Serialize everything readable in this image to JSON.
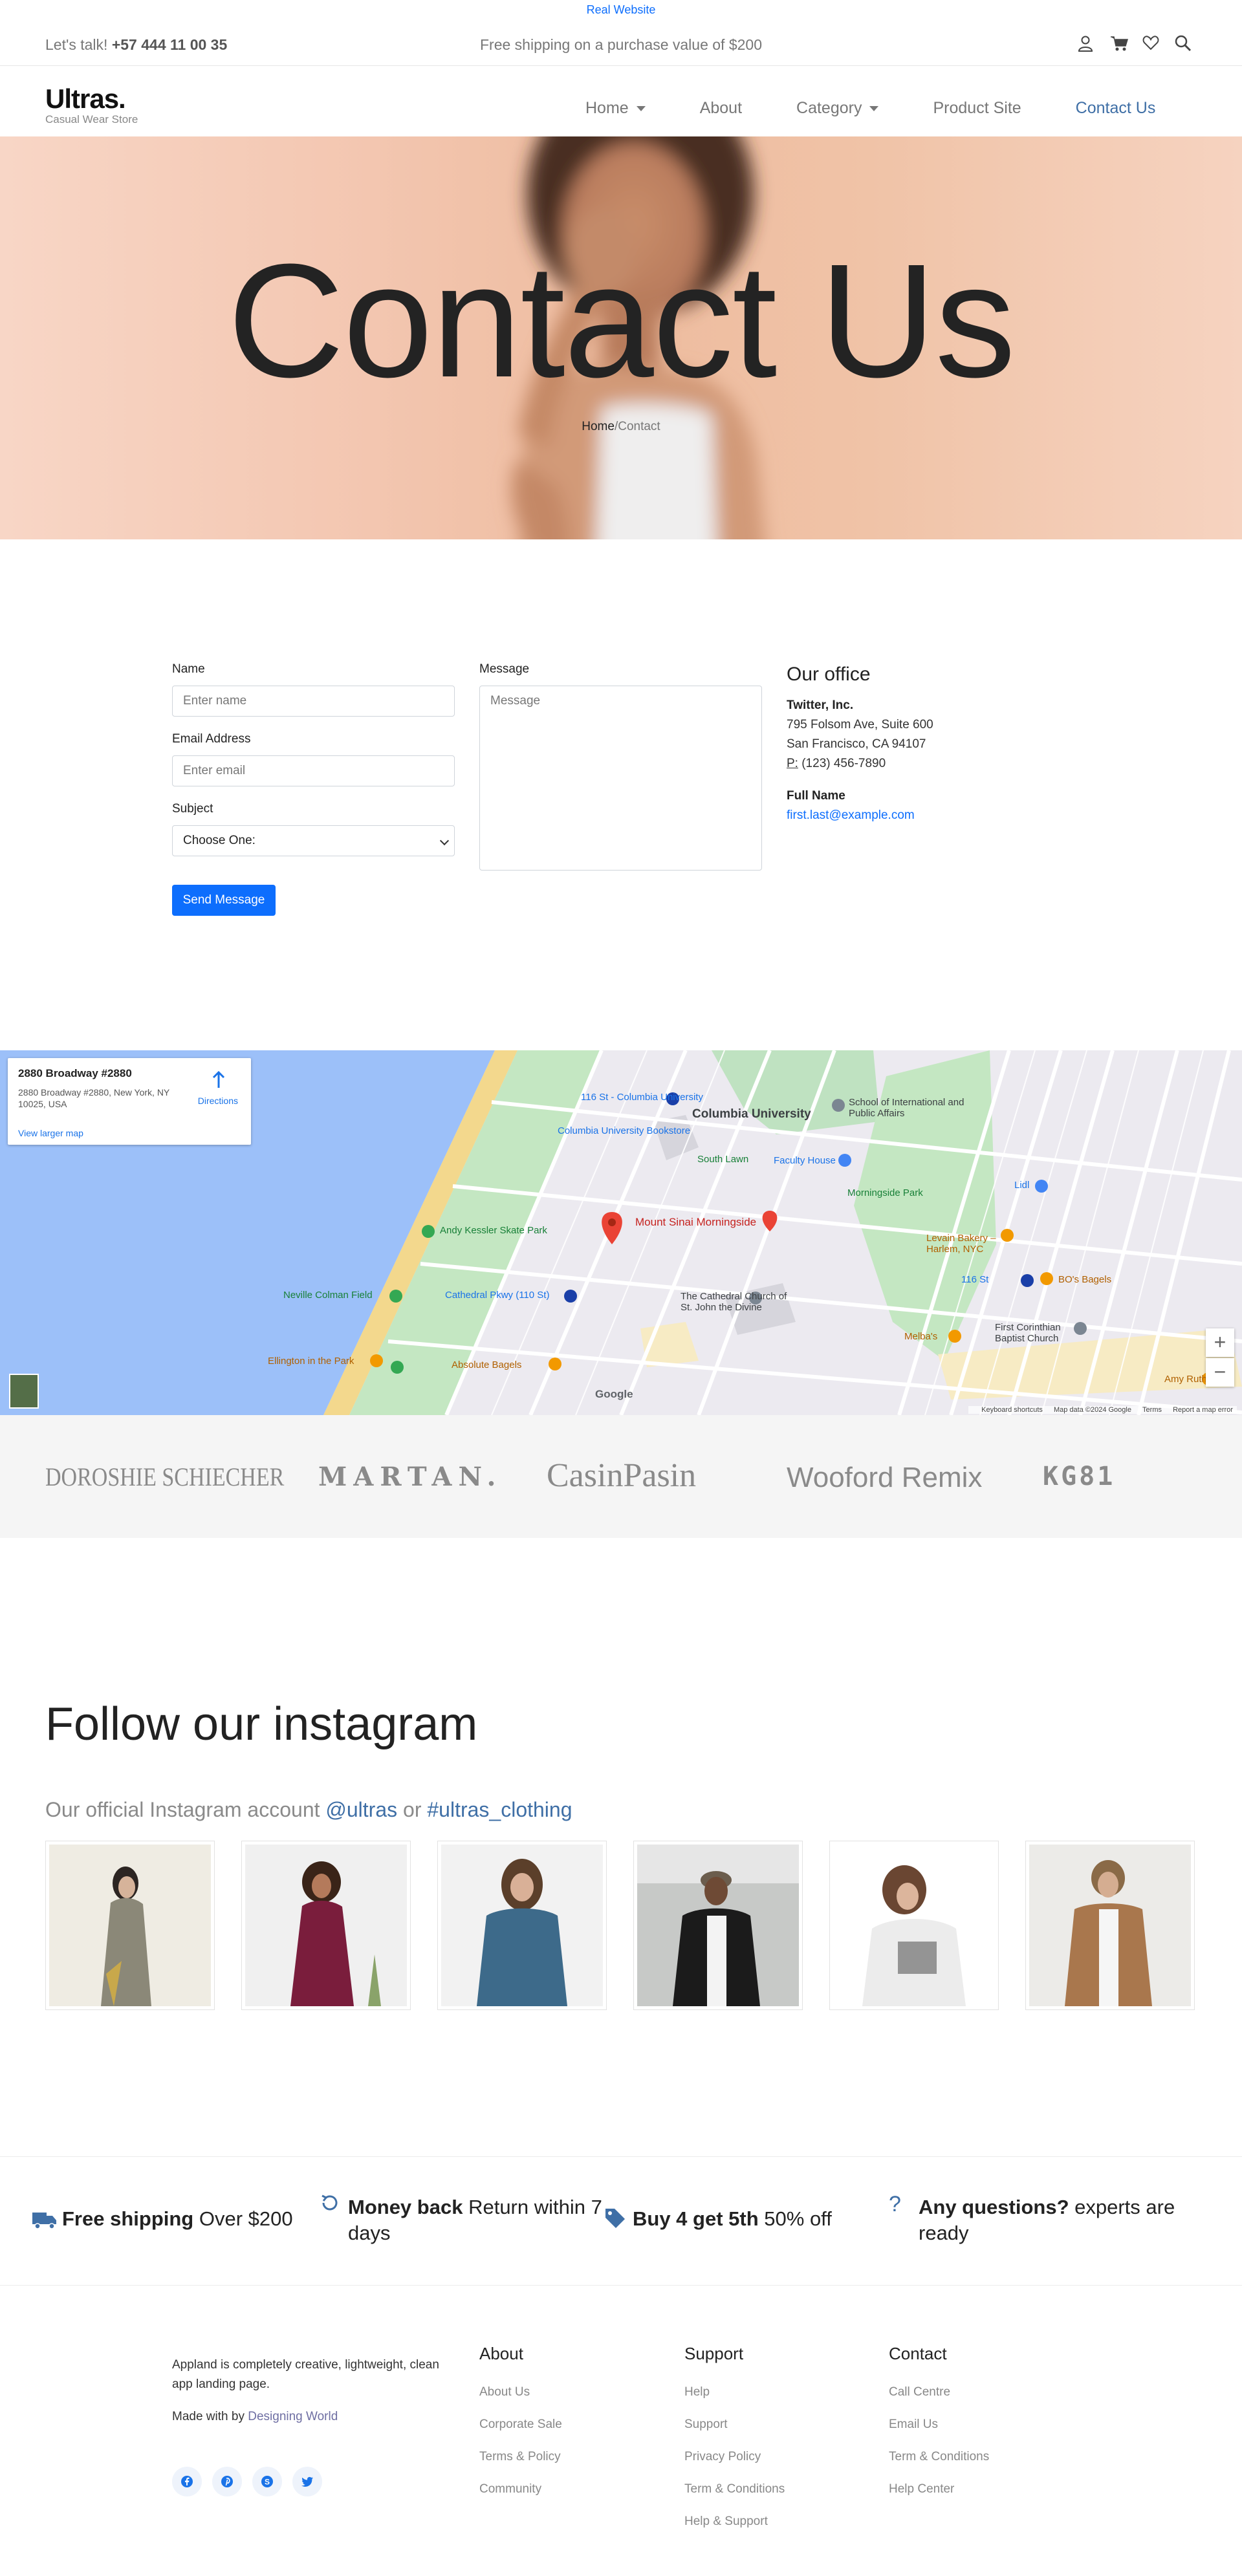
{
  "top_link": "Real Website",
  "topbar": {
    "talk_label": "Let's talk!",
    "phone": "+57 444 11 00 35",
    "shipping": "Free shipping on a purchase value of $200"
  },
  "brand": {
    "name": "Ultras.",
    "tagline": "Casual Wear Store"
  },
  "nav": {
    "home": "Home",
    "about": "About",
    "category": "Category",
    "product": "Product Site",
    "contact": "Contact Us"
  },
  "hero": {
    "title": "Contact Us",
    "breadcrumb_home": "Home",
    "breadcrumb_sep": "/",
    "breadcrumb_current": "Contact"
  },
  "form": {
    "name_label": "Name",
    "name_placeholder": "Enter name",
    "email_label": "Email Address",
    "email_placeholder": "Enter email",
    "subject_label": "Subject",
    "subject_value": "Choose One:",
    "message_label": "Message",
    "message_placeholder": "Message",
    "submit": "Send Message"
  },
  "office": {
    "title": "Our office",
    "company": "Twitter, Inc.",
    "address1": "795 Folsom Ave, Suite 600",
    "address2": "San Francisco, CA 94107",
    "phone_prefix": "P:",
    "phone": "(123) 456-7890",
    "contact_name": "Full Name",
    "email": "first.last@example.com"
  },
  "map": {
    "card_title": "2880 Broadway #2880",
    "card_address": "2880 Broadway #2880, New York, NY 10025, USA",
    "directions": "Directions",
    "larger_map": "View larger map",
    "marker_label": "Mount Sinai Morningside",
    "google": "Google",
    "footer": [
      "Keyboard shortcuts",
      "Map data ©2024 Google",
      "Terms",
      "Report a map error"
    ],
    "labels": {
      "columbia": "Columbia University",
      "bookstore": "Columbia University Bookstore",
      "sipa": "School of International and Public Affairs",
      "station116": "116 St - Columbia University",
      "south_lawn": "South Lawn",
      "faculty": "Faculty House",
      "morningside": "Morningside Park",
      "kessler": "Andy Kessler Skate Park",
      "coleman": "Neville Colman Field",
      "cathedral_pkwy": "Cathedral Pkwy (110 St)",
      "church": "The Cathedral Church of St. John the Divine",
      "levain": "Levain Bakery – Harlem, NYC",
      "bos": "BO's Bagels",
      "station116b": "116 St",
      "melbas": "Melba's",
      "baptist": "First Corinthian Baptist Church",
      "amy": "Amy Ruth's",
      "absolute": "Absolute Bagels",
      "ellington": "Ellington in the Park",
      "lidl": "Lidl"
    }
  },
  "brands": [
    "DOROSHIE SCHIECHER",
    "MARTAN.",
    "CasinPasin",
    "Wooford Remix",
    "KG81"
  ],
  "instagram": {
    "title": "Follow our instagram",
    "sub_text": "Our official Instagram account",
    "handle": "@ultras",
    "or": "or",
    "hashtag": "#ultras_clothing"
  },
  "features": [
    {
      "title": "Free shipping",
      "text": "Over $200"
    },
    {
      "title": "Money back",
      "text": "Return within 7 days"
    },
    {
      "title": "Buy 4 get 5th",
      "text": "50% off"
    },
    {
      "title": "Any questions?",
      "text": "experts are ready"
    }
  ],
  "footer": {
    "about_text": "Appland is completely creative, lightweight, clean app landing page.",
    "made_with": "Made with",
    "by": "by",
    "designer": "Designing World",
    "about": {
      "title": "About",
      "links": [
        "About Us",
        "Corporate Sale",
        "Terms & Policy",
        "Community"
      ]
    },
    "support": {
      "title": "Support",
      "links": [
        "Help",
        "Support",
        "Privacy Policy",
        "Term & Conditions",
        "Help & Support"
      ]
    },
    "contact": {
      "title": "Contact",
      "links": [
        "Call Centre",
        "Email Us",
        "Term & Conditions",
        "Help Center"
      ]
    }
  },
  "colors": {
    "primary": "#0d6efd",
    "nav_active": "#3f6fa6",
    "muted": "#777777"
  }
}
